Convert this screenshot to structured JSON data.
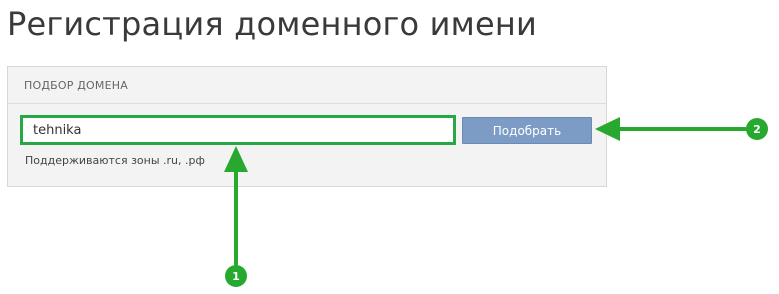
{
  "page": {
    "title": "Регистрация доменного имени"
  },
  "domain_search": {
    "section_title": "ПОДБОР ДОМЕНА",
    "input_value": "tehnika",
    "button_label": "Подобрать",
    "hint": "Поддерживаются зоны .ru, .рф"
  },
  "annotations": {
    "accent_color": "#28a745",
    "badges": [
      {
        "number": "1",
        "target": "domain-input"
      },
      {
        "number": "2",
        "target": "pick-button"
      }
    ]
  }
}
